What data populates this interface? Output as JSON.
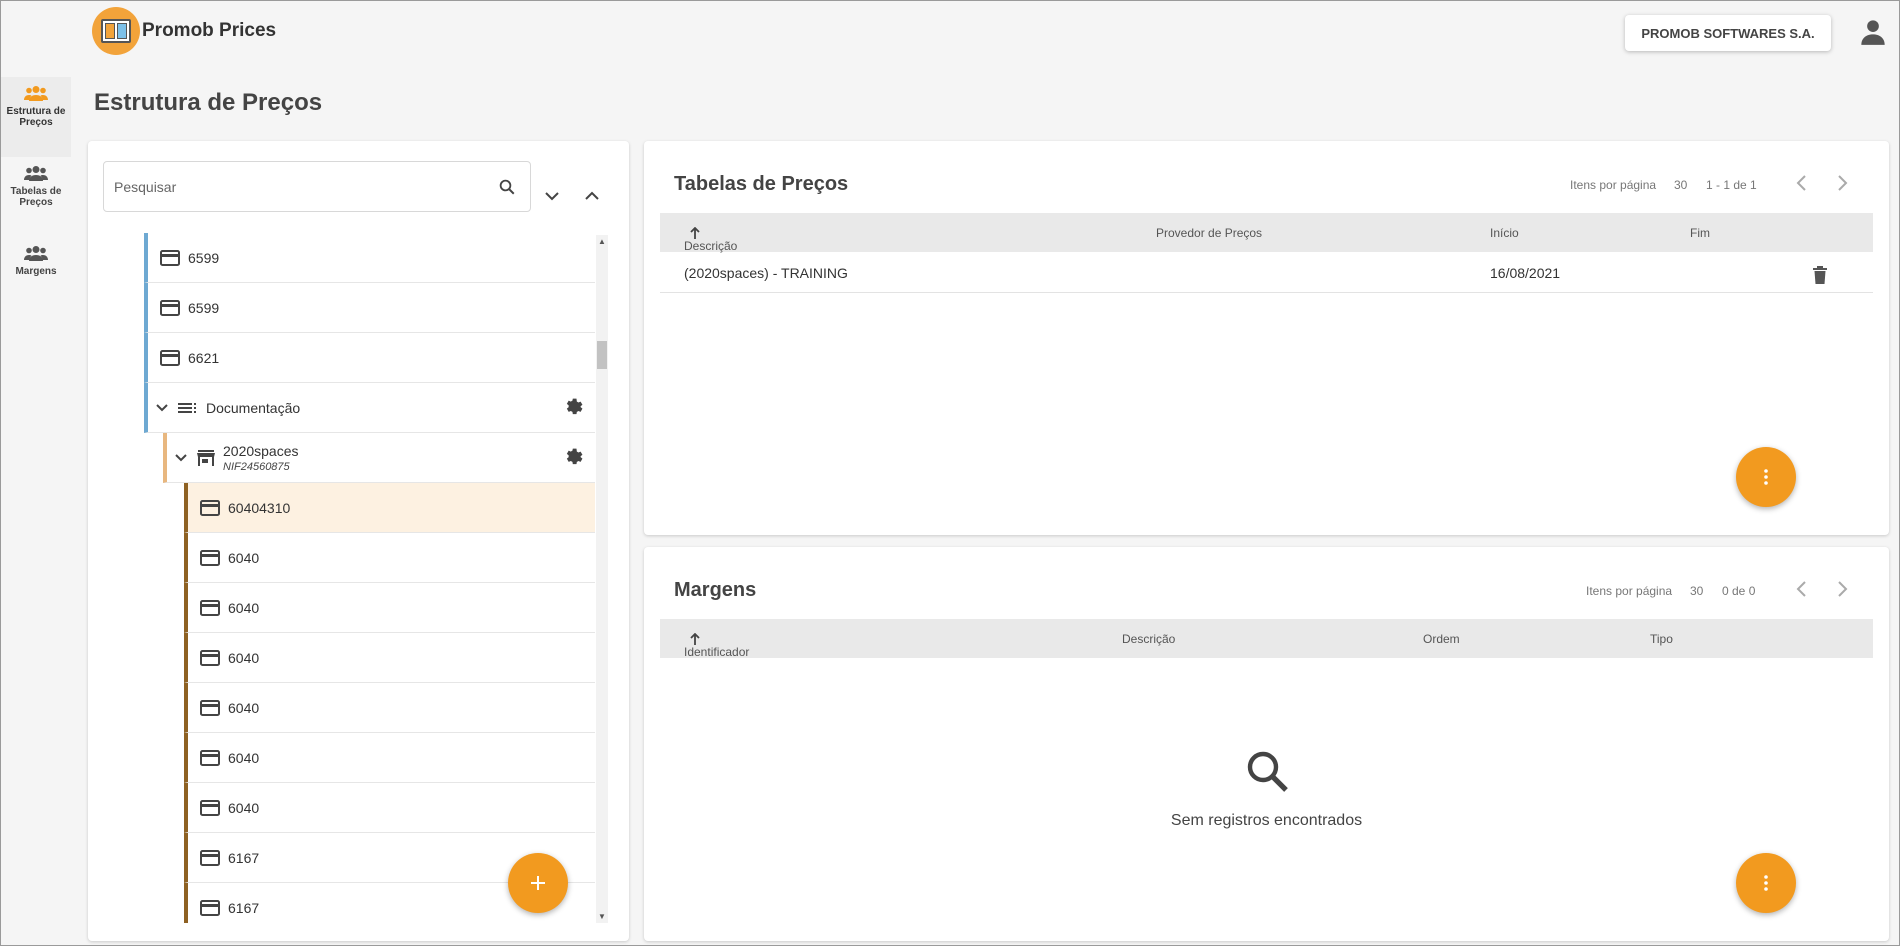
{
  "app": {
    "title": "Promob Prices",
    "company": "PROMOB SOFTWARES S.A."
  },
  "nav": [
    {
      "label": "Estrutura de Preços",
      "icon": "people-icon",
      "active": true
    },
    {
      "label": "Tabelas de Preços",
      "icon": "people-icon",
      "active": false
    },
    {
      "label": "Margens",
      "icon": "people-icon",
      "active": false
    }
  ],
  "page": {
    "title": "Estrutura de Preços"
  },
  "search": {
    "placeholder": "Pesquisar"
  },
  "tree": [
    {
      "label": "6599",
      "level": 1,
      "icon": "card-icon"
    },
    {
      "label": "6599",
      "level": 1,
      "icon": "card-icon"
    },
    {
      "label": "6621",
      "level": 1,
      "icon": "card-icon"
    },
    {
      "label": "Documentação",
      "level": 1,
      "icon": "list-icon",
      "expanded": true,
      "gear": true
    },
    {
      "label": "2020spaces",
      "sublabel": "NIF24560875",
      "level": 2,
      "icon": "store-icon",
      "expanded": true,
      "gear": true
    },
    {
      "label": "60404310",
      "level": 3,
      "icon": "card-icon",
      "selected": true
    },
    {
      "label": "6040",
      "level": 3,
      "icon": "card-icon"
    },
    {
      "label": "6040",
      "level": 3,
      "icon": "card-icon"
    },
    {
      "label": "6040",
      "level": 3,
      "icon": "card-icon"
    },
    {
      "label": "6040",
      "level": 3,
      "icon": "card-icon"
    },
    {
      "label": "6040",
      "level": 3,
      "icon": "card-icon"
    },
    {
      "label": "6040",
      "level": 3,
      "icon": "card-icon"
    },
    {
      "label": "6167",
      "level": 3,
      "icon": "card-icon"
    },
    {
      "label": "6167",
      "level": 3,
      "icon": "card-icon"
    }
  ],
  "tabelas": {
    "title": "Tabelas de Preços",
    "items_per_page_label": "Itens por página",
    "items_per_page": "30",
    "range": "1 - 1 de 1",
    "columns": [
      "Descrição",
      "Provedor de Preços",
      "Início",
      "Fim"
    ],
    "rows": [
      {
        "descricao": "(2020spaces) - TRAINING",
        "provedor": "",
        "inicio": "16/08/2021",
        "fim": ""
      }
    ]
  },
  "margens": {
    "title": "Margens",
    "items_per_page_label": "Itens por página",
    "items_per_page": "30",
    "range": "0 de 0",
    "columns": [
      "Identificador",
      "Descrição",
      "Ordem",
      "Tipo"
    ],
    "empty_text": "Sem registros encontrados"
  },
  "colors": {
    "accent": "#f29a1f",
    "level1": "#6ea9d2",
    "level2": "#e8b77f",
    "level3": "#8e6122",
    "selected": "#fdf1e1"
  }
}
